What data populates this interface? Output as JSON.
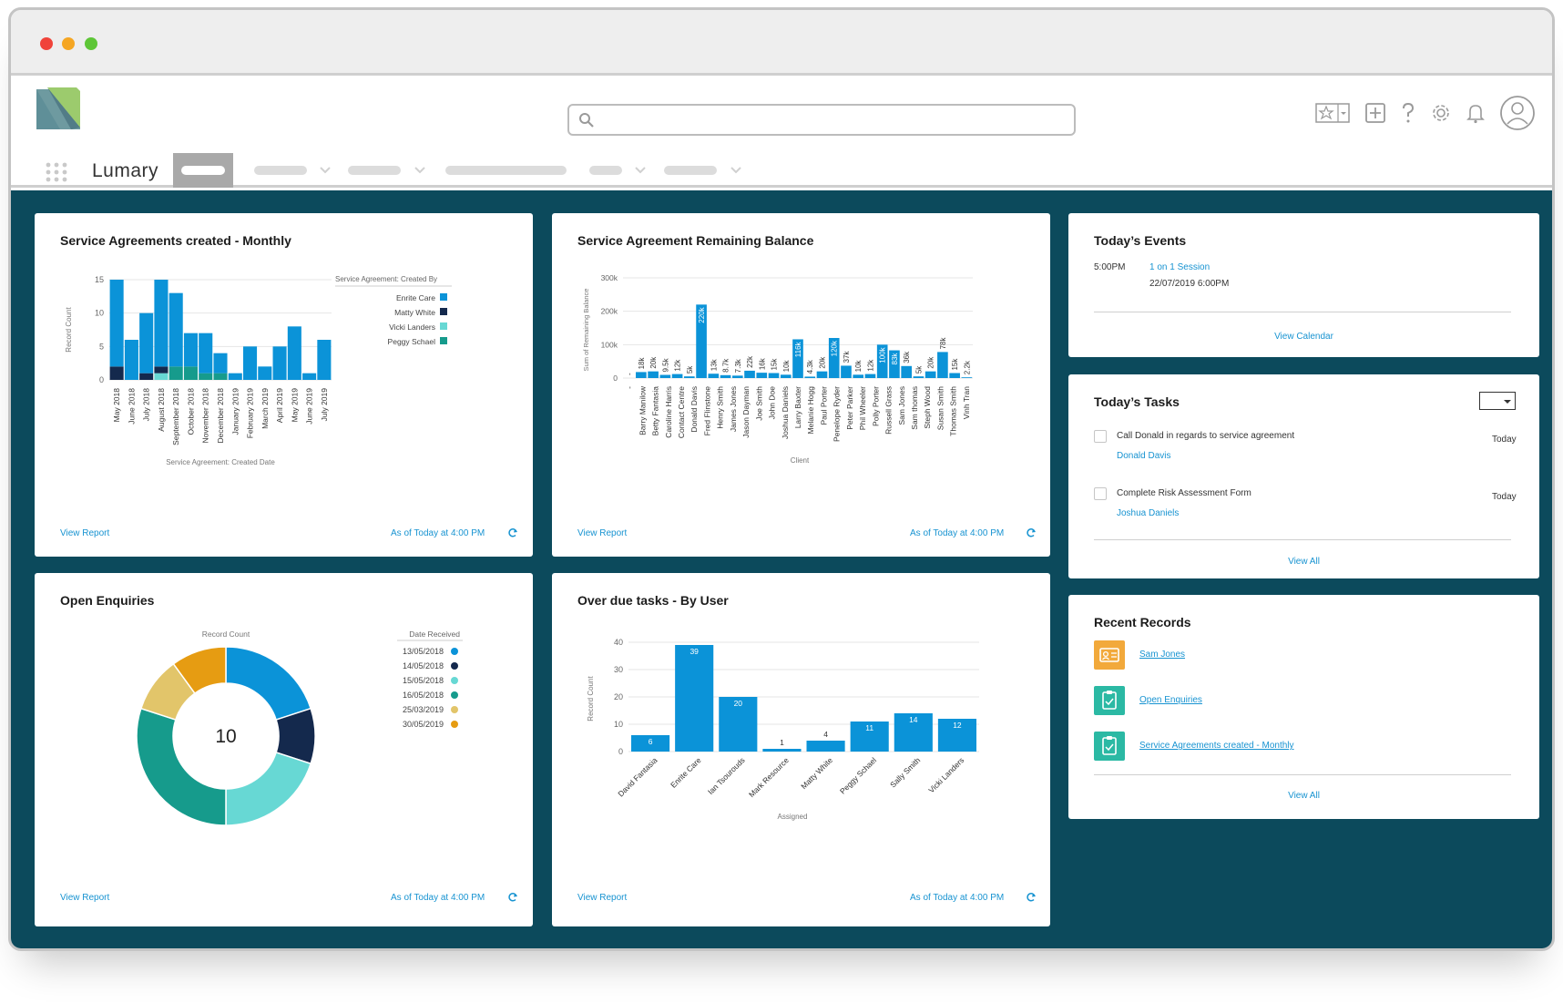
{
  "app": {
    "name": "Lumary",
    "colors": {
      "brand_teal": "#0c4a5c",
      "link": "#1793d1",
      "bar": "#0b93d8",
      "navy": "#14294d",
      "aqua": "#67d8d4",
      "green": "#169b8c"
    }
  },
  "header": {
    "search_placeholder": "",
    "icons": [
      "favorites-icon",
      "add-icon",
      "help-icon",
      "settings-icon",
      "notifications-icon",
      "avatar-icon"
    ]
  },
  "card1": {
    "title": "Service Agreements created - Monthly",
    "footer_link": "View Report",
    "footer_time": "As of Today at 4:00 PM"
  },
  "card2": {
    "title": "Service Agreement Remaining Balance",
    "footer_link": "View Report",
    "footer_time": "As of Today at 4:00 PM"
  },
  "card3": {
    "title": "Open Enquiries",
    "center_value": "10",
    "footer_link": "View Report",
    "footer_time": "As of Today at 4:00 PM"
  },
  "card4": {
    "title": "Over due tasks - By User",
    "footer_link": "View Report",
    "footer_time": "As of Today at 4:00 PM"
  },
  "events": {
    "title": "Today’s Events",
    "time": "5:00PM",
    "event_name": "1 on 1 Session",
    "event_date": "22/07/2019 6:00PM",
    "view_link": "View Calendar"
  },
  "tasks": {
    "title": "Today’s Tasks",
    "items": [
      {
        "text": "Call Donald in regards to service agreement",
        "person": "Donald Davis",
        "due": "Today"
      },
      {
        "text": "Complete Risk Assessment Form",
        "person": "Joshua Daniels",
        "due": "Today"
      }
    ],
    "view_link": "View All"
  },
  "recent": {
    "title": "Recent Records",
    "items": [
      {
        "label": "Sam Jones",
        "icon": "contact-card-icon",
        "color": "#f2a93b"
      },
      {
        "label": "Open Enquiries",
        "icon": "clipboard-icon",
        "color": "#2bb9a4"
      },
      {
        "label": "Service Agreements created - Monthly",
        "icon": "clipboard-icon",
        "color": "#2bb9a4"
      }
    ],
    "view_link": "View All"
  },
  "chart_data": [
    {
      "type": "bar",
      "stacked": true,
      "title": "Service Agreements created - Monthly",
      "xlabel": "Service Agreement: Created Date",
      "ylabel": "Record Count",
      "ylim": [
        0,
        15
      ],
      "yticks": [
        0,
        5,
        10,
        15
      ],
      "categories": [
        "May 2018",
        "June 2018",
        "July 2018",
        "August 2018",
        "September 2018",
        "October 2018",
        "November 2018",
        "December 2018",
        "January 2019",
        "February 2019",
        "March 2019",
        "April 2019",
        "May 2019",
        "June 2019",
        "July 2019"
      ],
      "legend_title": "Service Agreement: Created By",
      "legend_position": "right",
      "series": [
        {
          "name": "Peggy Schael",
          "color": "#169b8c",
          "values": [
            0,
            0,
            0,
            0,
            2,
            2,
            1,
            1,
            0,
            0,
            0,
            0,
            0,
            0,
            0
          ]
        },
        {
          "name": "Vicki Landers",
          "color": "#67d8d4",
          "values": [
            0,
            0,
            0,
            1,
            0,
            0,
            0,
            0,
            0,
            0,
            0,
            0,
            0,
            0,
            0
          ]
        },
        {
          "name": "Matty White",
          "color": "#14294d",
          "values": [
            2,
            0,
            1,
            1,
            0,
            0,
            0,
            0,
            0,
            0,
            0,
            0,
            0,
            0,
            0
          ]
        },
        {
          "name": "Enrite Care",
          "color": "#0b93d8",
          "values": [
            13,
            6,
            9,
            13,
            11,
            5,
            6,
            3,
            1,
            5,
            2,
            5,
            8,
            1,
            6
          ]
        }
      ]
    },
    {
      "type": "bar",
      "title": "Service Agreement Remaining Balance",
      "xlabel": "Client",
      "ylabel": "Sum of Remaining Balance",
      "ylim": [
        0,
        300000
      ],
      "yticks": [
        "0",
        "100k",
        "200k",
        "300k"
      ],
      "categories": [
        "-",
        "Barry Manilow",
        "Betty Fantasia",
        "Caroline Harris",
        "Contact Centre",
        "Donald Davis",
        "Fred Flinstone",
        "Henry Smith",
        "James Jones",
        "Jason Dayman",
        "Joe Smith",
        "John Doe",
        "Joshua Daniels",
        "Larry Baxter",
        "Melanie Hogg",
        "Paul Porter",
        "Penelope Ryder",
        "Peter Parker",
        "Phil Wheeler",
        "Polly Porter",
        "Russell Grass",
        "Sam Jones",
        "Sam thomas",
        "Steph Wood",
        "Susan Smith",
        "Thomas Smith",
        "Vinh Tran"
      ],
      "values": [
        0,
        18000,
        20000,
        9500,
        12000,
        5000,
        220000,
        13000,
        8700,
        7300,
        22000,
        16000,
        15000,
        10000,
        116000,
        4300,
        20000,
        120000,
        37000,
        10000,
        12000,
        100000,
        83000,
        36000,
        5000,
        20000,
        78000,
        15000,
        2200
      ],
      "labels": [
        "-",
        "18k",
        "20k",
        "9.5k",
        "12k",
        "5k",
        "220k",
        "13k",
        "8.7k",
        "7.3k",
        "22k",
        "16k",
        "15k",
        "10k",
        "116k",
        "4.3k",
        "20k",
        "120k",
        "37k",
        "10k",
        "12k",
        "100k",
        "83k",
        "36k",
        "5k",
        "20k",
        "78k",
        "15k",
        "2.2k"
      ]
    },
    {
      "type": "pie",
      "donut": true,
      "title": "Open Enquiries",
      "value_label": "Record Count",
      "legend_title": "Date Received",
      "legend_position": "right",
      "total": 10,
      "slices": [
        {
          "name": "13/05/2018",
          "value": 2,
          "color": "#0b93d8"
        },
        {
          "name": "14/05/2018",
          "value": 1,
          "color": "#14294d"
        },
        {
          "name": "15/05/2018",
          "value": 2,
          "color": "#67d8d4"
        },
        {
          "name": "16/05/2018",
          "value": 3,
          "color": "#169b8c"
        },
        {
          "name": "25/03/2019",
          "value": 1,
          "color": "#e2c56a"
        },
        {
          "name": "30/05/2019",
          "value": 1,
          "color": "#e69c12"
        }
      ]
    },
    {
      "type": "bar",
      "title": "Over due tasks - By User",
      "xlabel": "Assigned",
      "ylabel": "Record Count",
      "ylim": [
        0,
        40
      ],
      "yticks": [
        0,
        10,
        20,
        30,
        40
      ],
      "categories": [
        "David Fantasia",
        "Enrite Care",
        "Ian Tsourouds",
        "Mark Resource",
        "Matty White",
        "Peggy Schael",
        "Sally Smith",
        "Vicki Landers"
      ],
      "values": [
        6,
        39,
        20,
        1,
        4,
        11,
        14,
        12
      ]
    }
  ]
}
